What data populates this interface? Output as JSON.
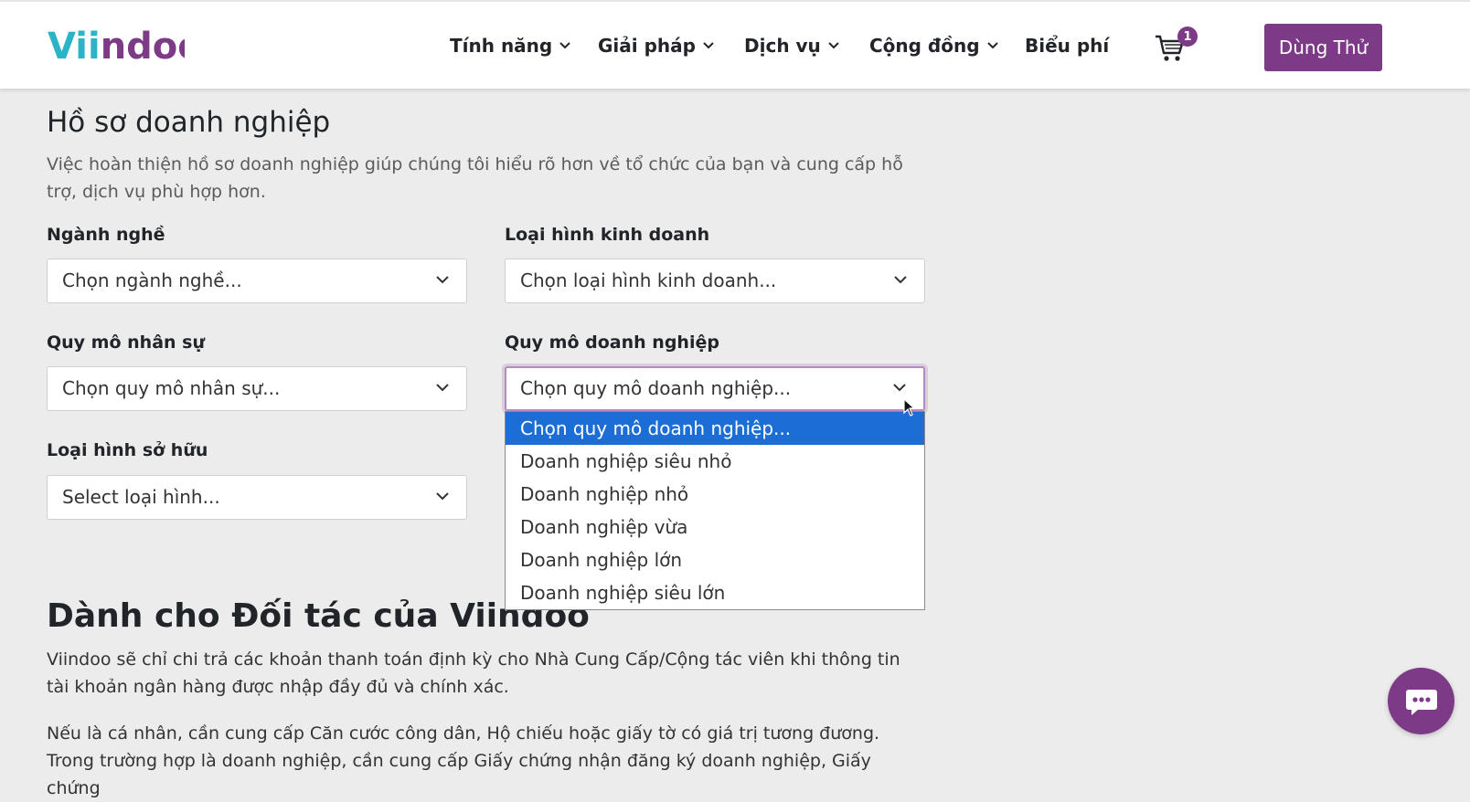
{
  "header": {
    "logo_text": "Viindoo",
    "nav": [
      {
        "label": "Tính năng"
      },
      {
        "label": "Giải pháp"
      },
      {
        "label": "Dịch vụ"
      },
      {
        "label": "Cộng đồng"
      },
      {
        "label": "Biểu phí"
      }
    ],
    "cart_count": "1",
    "try_button": "Dùng Thử"
  },
  "profile": {
    "title": "Hồ sơ doanh nghiệp",
    "description": "Việc hoàn thiện hồ sơ doanh nghiệp giúp chúng tôi hiểu rõ hơn về tổ chức của bạn và cung cấp hỗ trợ, dịch vụ phù hợp hơn.",
    "fields": {
      "industry": {
        "label": "Ngành nghề",
        "value": "Chọn ngành nghề..."
      },
      "business_type": {
        "label": "Loại hình kinh doanh",
        "value": "Chọn loại hình kinh doanh..."
      },
      "staff_size": {
        "label": "Quy mô nhân sự",
        "value": "Chọn quy mô nhân sự..."
      },
      "company_size": {
        "label": "Quy mô doanh nghiệp",
        "value": "Chọn quy mô doanh nghiệp..."
      },
      "ownership": {
        "label": "Loại hình sở hữu",
        "value": "Select loại hình..."
      }
    },
    "company_size_options": [
      "Chọn quy mô doanh nghiệp...",
      "Doanh nghiệp siêu nhỏ",
      "Doanh nghiệp nhỏ",
      "Doanh nghiệp vừa",
      "Doanh nghiệp lớn",
      "Doanh nghiệp siêu lớn"
    ]
  },
  "partner": {
    "title": "Dành cho Đối tác của Viindoo",
    "paragraph1": "Viindoo sẽ chỉ chi trả các khoản thanh toán định kỳ cho Nhà Cung Cấp/Cộng tác viên khi thông tin tài khoản ngân hàng được nhập đầy đủ và chính xác.",
    "paragraph2": "Nếu là cá nhân, cần cung cấp Căn cước công dân, Hộ chiếu hoặc giấy tờ có giá trị tương đương. Trong trường hợp là doanh nghiệp, cần cung cấp Giấy chứng nhận đăng ký doanh nghiệp, Giấy chứng"
  },
  "colors": {
    "brand_purple": "#7c3a87",
    "logo_teal": "#2bb3c8",
    "selected_option": "#1c6ed6"
  },
  "icons": [
    "chevron-down-icon",
    "cart-icon",
    "chat-icon",
    "mouse-cursor-icon"
  ]
}
